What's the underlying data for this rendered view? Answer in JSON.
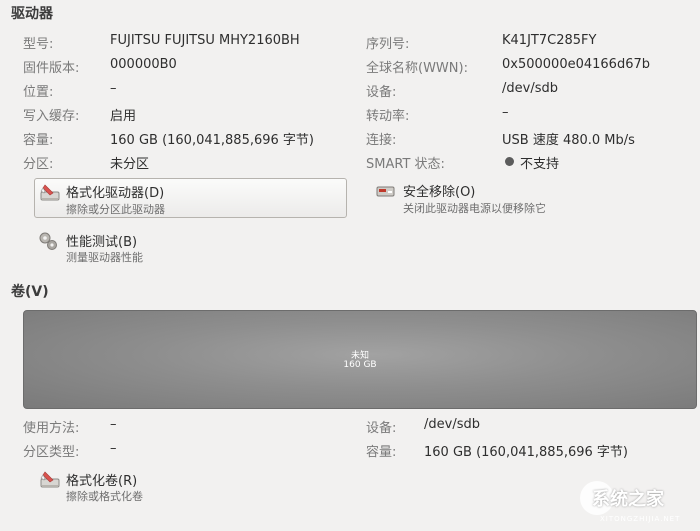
{
  "drive": {
    "heading": "驱动器",
    "left": [
      {
        "label": "型号:",
        "value": "FUJITSU FUJITSU MHY2160BH"
      },
      {
        "label": "固件版本:",
        "value": "000000B0"
      },
      {
        "label": "位置:",
        "value": "–"
      },
      {
        "label": "写入缓存:",
        "value": "启用"
      },
      {
        "label": "容量:",
        "value": "160 GB (160,041,885,696 字节)"
      },
      {
        "label": "分区:",
        "value": "未分区"
      }
    ],
    "right": [
      {
        "label": "序列号:",
        "value": "K41JT7C285FY"
      },
      {
        "label": "全球名称(WWN):",
        "value": "0x500000e04166d67b"
      },
      {
        "label": "设备:",
        "value": "/dev/sdb"
      },
      {
        "label": "转动率:",
        "value": "–"
      },
      {
        "label": "连接:",
        "value": "USB 速度 480.0 Mb/s"
      },
      {
        "label": "SMART 状态:",
        "value": "不支持"
      }
    ],
    "actions": {
      "format": {
        "title": "格式化驱动器(D)",
        "subtitle": "擦除或分区此驱动器"
      },
      "eject": {
        "title": "安全移除(O)",
        "subtitle": "关闭此驱动器电源以便移除它"
      },
      "benchmark": {
        "title": "性能测试(B)",
        "subtitle": "测量驱动器性能"
      }
    }
  },
  "volumes": {
    "heading": "卷(V)",
    "bar": {
      "name": "未知",
      "size": "160 GB"
    },
    "left": [
      {
        "label": "使用方法:",
        "value": "–"
      },
      {
        "label": "分区类型:",
        "value": "–"
      }
    ],
    "right": [
      {
        "label": "设备:",
        "value": "/dev/sdb"
      },
      {
        "label": "容量:",
        "value": "160 GB (160,041,885,696 字节)"
      }
    ],
    "actions": {
      "format_volume": {
        "title": "格式化卷(R)",
        "subtitle": "擦除或格式化卷"
      }
    }
  },
  "watermark": {
    "text": "系统之家",
    "sub": "XITONGZHIJIA.NET"
  }
}
